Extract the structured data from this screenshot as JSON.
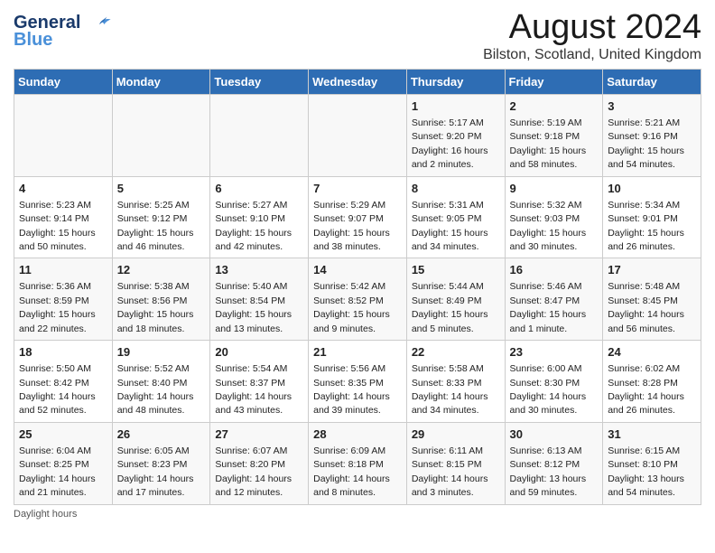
{
  "header": {
    "logo_line1": "General",
    "logo_line2": "Blue",
    "month_title": "August 2024",
    "location": "Bilston, Scotland, United Kingdom"
  },
  "weekdays": [
    "Sunday",
    "Monday",
    "Tuesday",
    "Wednesday",
    "Thursday",
    "Friday",
    "Saturday"
  ],
  "weeks": [
    [
      {
        "day": "",
        "info": ""
      },
      {
        "day": "",
        "info": ""
      },
      {
        "day": "",
        "info": ""
      },
      {
        "day": "",
        "info": ""
      },
      {
        "day": "1",
        "info": "Sunrise: 5:17 AM\nSunset: 9:20 PM\nDaylight: 16 hours\nand 2 minutes."
      },
      {
        "day": "2",
        "info": "Sunrise: 5:19 AM\nSunset: 9:18 PM\nDaylight: 15 hours\nand 58 minutes."
      },
      {
        "day": "3",
        "info": "Sunrise: 5:21 AM\nSunset: 9:16 PM\nDaylight: 15 hours\nand 54 minutes."
      }
    ],
    [
      {
        "day": "4",
        "info": "Sunrise: 5:23 AM\nSunset: 9:14 PM\nDaylight: 15 hours\nand 50 minutes."
      },
      {
        "day": "5",
        "info": "Sunrise: 5:25 AM\nSunset: 9:12 PM\nDaylight: 15 hours\nand 46 minutes."
      },
      {
        "day": "6",
        "info": "Sunrise: 5:27 AM\nSunset: 9:10 PM\nDaylight: 15 hours\nand 42 minutes."
      },
      {
        "day": "7",
        "info": "Sunrise: 5:29 AM\nSunset: 9:07 PM\nDaylight: 15 hours\nand 38 minutes."
      },
      {
        "day": "8",
        "info": "Sunrise: 5:31 AM\nSunset: 9:05 PM\nDaylight: 15 hours\nand 34 minutes."
      },
      {
        "day": "9",
        "info": "Sunrise: 5:32 AM\nSunset: 9:03 PM\nDaylight: 15 hours\nand 30 minutes."
      },
      {
        "day": "10",
        "info": "Sunrise: 5:34 AM\nSunset: 9:01 PM\nDaylight: 15 hours\nand 26 minutes."
      }
    ],
    [
      {
        "day": "11",
        "info": "Sunrise: 5:36 AM\nSunset: 8:59 PM\nDaylight: 15 hours\nand 22 minutes."
      },
      {
        "day": "12",
        "info": "Sunrise: 5:38 AM\nSunset: 8:56 PM\nDaylight: 15 hours\nand 18 minutes."
      },
      {
        "day": "13",
        "info": "Sunrise: 5:40 AM\nSunset: 8:54 PM\nDaylight: 15 hours\nand 13 minutes."
      },
      {
        "day": "14",
        "info": "Sunrise: 5:42 AM\nSunset: 8:52 PM\nDaylight: 15 hours\nand 9 minutes."
      },
      {
        "day": "15",
        "info": "Sunrise: 5:44 AM\nSunset: 8:49 PM\nDaylight: 15 hours\nand 5 minutes."
      },
      {
        "day": "16",
        "info": "Sunrise: 5:46 AM\nSunset: 8:47 PM\nDaylight: 15 hours\nand 1 minute."
      },
      {
        "day": "17",
        "info": "Sunrise: 5:48 AM\nSunset: 8:45 PM\nDaylight: 14 hours\nand 56 minutes."
      }
    ],
    [
      {
        "day": "18",
        "info": "Sunrise: 5:50 AM\nSunset: 8:42 PM\nDaylight: 14 hours\nand 52 minutes."
      },
      {
        "day": "19",
        "info": "Sunrise: 5:52 AM\nSunset: 8:40 PM\nDaylight: 14 hours\nand 48 minutes."
      },
      {
        "day": "20",
        "info": "Sunrise: 5:54 AM\nSunset: 8:37 PM\nDaylight: 14 hours\nand 43 minutes."
      },
      {
        "day": "21",
        "info": "Sunrise: 5:56 AM\nSunset: 8:35 PM\nDaylight: 14 hours\nand 39 minutes."
      },
      {
        "day": "22",
        "info": "Sunrise: 5:58 AM\nSunset: 8:33 PM\nDaylight: 14 hours\nand 34 minutes."
      },
      {
        "day": "23",
        "info": "Sunrise: 6:00 AM\nSunset: 8:30 PM\nDaylight: 14 hours\nand 30 minutes."
      },
      {
        "day": "24",
        "info": "Sunrise: 6:02 AM\nSunset: 8:28 PM\nDaylight: 14 hours\nand 26 minutes."
      }
    ],
    [
      {
        "day": "25",
        "info": "Sunrise: 6:04 AM\nSunset: 8:25 PM\nDaylight: 14 hours\nand 21 minutes."
      },
      {
        "day": "26",
        "info": "Sunrise: 6:05 AM\nSunset: 8:23 PM\nDaylight: 14 hours\nand 17 minutes."
      },
      {
        "day": "27",
        "info": "Sunrise: 6:07 AM\nSunset: 8:20 PM\nDaylight: 14 hours\nand 12 minutes."
      },
      {
        "day": "28",
        "info": "Sunrise: 6:09 AM\nSunset: 8:18 PM\nDaylight: 14 hours\nand 8 minutes."
      },
      {
        "day": "29",
        "info": "Sunrise: 6:11 AM\nSunset: 8:15 PM\nDaylight: 14 hours\nand 3 minutes."
      },
      {
        "day": "30",
        "info": "Sunrise: 6:13 AM\nSunset: 8:12 PM\nDaylight: 13 hours\nand 59 minutes."
      },
      {
        "day": "31",
        "info": "Sunrise: 6:15 AM\nSunset: 8:10 PM\nDaylight: 13 hours\nand 54 minutes."
      }
    ]
  ],
  "footer": "Daylight hours"
}
